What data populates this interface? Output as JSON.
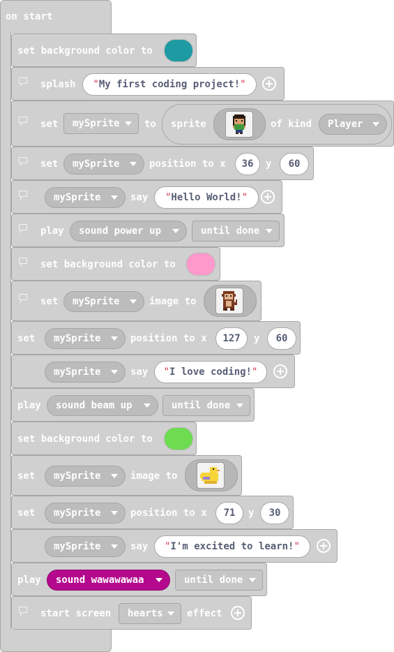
{
  "event": {
    "label": "on start"
  },
  "blocks": {
    "b1": {
      "label": "set background color to",
      "color": "#1e9aa3"
    },
    "b2": {
      "label": "splash",
      "text": "My first coding project!"
    },
    "b3": {
      "set": "set",
      "var": "mySprite",
      "to": "to",
      "sprite": "sprite",
      "of_kind": "of kind",
      "kind": "Player",
      "image": "pixel-character-icon"
    },
    "b4": {
      "set": "set",
      "var": "mySprite",
      "label": "position to x",
      "x": "36",
      "y_label": "y",
      "y": "60"
    },
    "b5": {
      "var": "mySprite",
      "say": "say",
      "text": "Hello World!"
    },
    "b6": {
      "play": "play",
      "sound": "sound power up",
      "mode": "until done"
    },
    "b7": {
      "label": "set background color to",
      "color": "#ff99cc"
    },
    "b8": {
      "set": "set",
      "var": "mySprite",
      "label": "image to",
      "image": "monkey-icon"
    },
    "b9": {
      "set": "set",
      "var": "mySprite",
      "label": "position to x",
      "x": "127",
      "y_label": "y",
      "y": "60"
    },
    "b10": {
      "var": "mySprite",
      "say": "say",
      "text": "I love coding!"
    },
    "b11": {
      "play": "play",
      "sound": "sound beam up",
      "mode": "until done"
    },
    "b12": {
      "label": "set background color to",
      "color": "#6edc50"
    },
    "b13": {
      "set": "set",
      "var": "mySprite",
      "label": "image to",
      "image": "duck-icon"
    },
    "b14": {
      "set": "set",
      "var": "mySprite",
      "label": "position to x",
      "x": "71",
      "y_label": "y",
      "y": "30"
    },
    "b15": {
      "var": "mySprite",
      "say": "say",
      "text": "I'm excited to learn!"
    },
    "b16": {
      "play": "play",
      "sound": "sound wawawawaa",
      "sound_color": "#b4088d",
      "mode": "until done"
    },
    "b17": {
      "label": "start screen",
      "effect": "hearts",
      "suffix": "effect"
    }
  },
  "quote_mark": "\""
}
